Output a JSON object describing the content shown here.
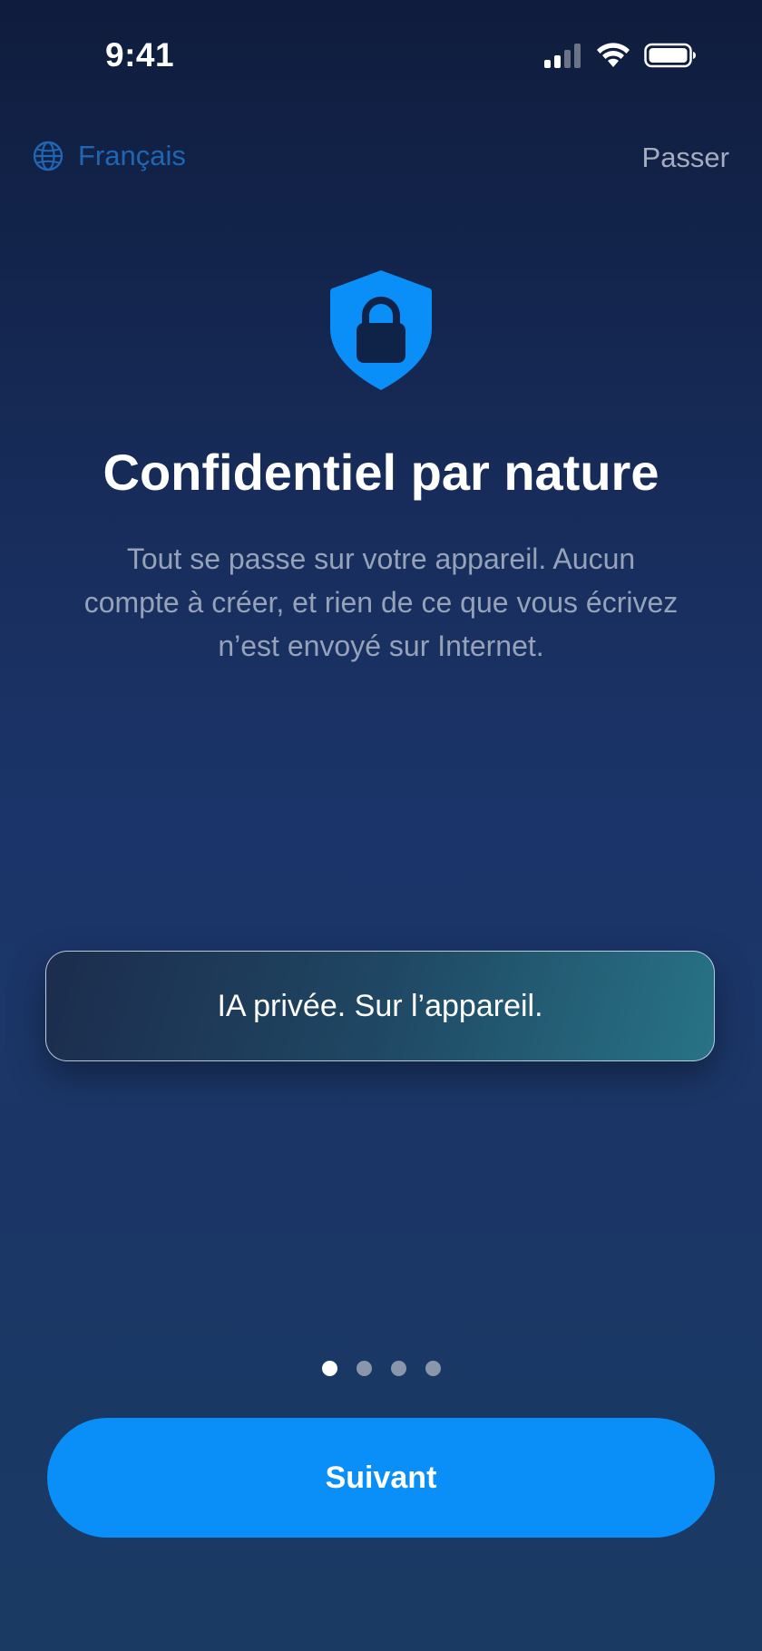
{
  "status_bar": {
    "time": "9:41",
    "icons": [
      "signal-icon",
      "wifi-icon",
      "battery-icon"
    ]
  },
  "top_bar": {
    "language_label": "Français",
    "language_icon": "globe-icon",
    "skip_label": "Passer"
  },
  "hero": {
    "icon": "shield-lock-icon",
    "title": "Confidentiel par nature",
    "subtitle": "Tout se passe sur votre appareil. Aucun compte à créer, et rien de ce que vous écrivez n’est envoyé sur Internet."
  },
  "feature_card": {
    "text": "IA privée. Sur l’appareil."
  },
  "pagination": {
    "total": 4,
    "current": 1
  },
  "primary_button": {
    "label": "Suivant"
  },
  "colors": {
    "accent": "#0a8ff8",
    "language_link": "#1f66b3",
    "shield": "#0a8ff8"
  }
}
